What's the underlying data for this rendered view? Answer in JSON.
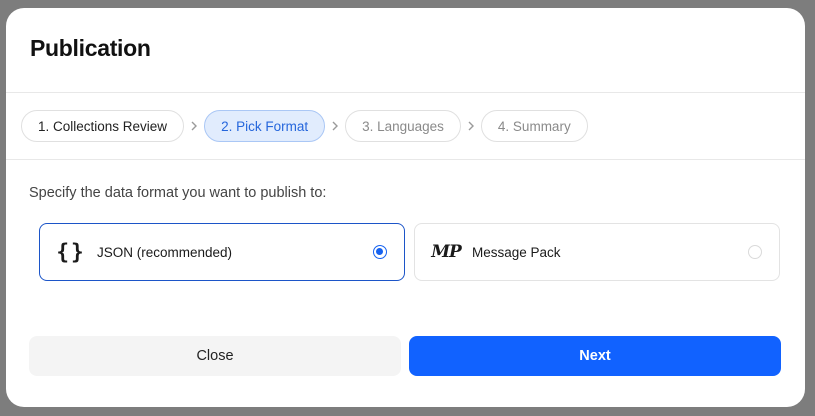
{
  "modal": {
    "title": "Publication"
  },
  "steps": [
    {
      "label": "1. Collections Review",
      "state": "done"
    },
    {
      "label": "2. Pick Format",
      "state": "active"
    },
    {
      "label": "3. Languages",
      "state": "pending"
    },
    {
      "label": "4. Summary",
      "state": "pending"
    }
  ],
  "prompt": "Specify the data format you want to publish to:",
  "options": [
    {
      "icon": "json-braces-icon",
      "glyph": "{}",
      "label": "JSON (recommended)",
      "selected": true
    },
    {
      "icon": "message-pack-icon",
      "glyph": "MP",
      "label": "Message Pack",
      "selected": false
    }
  ],
  "footer": {
    "close_label": "Close",
    "next_label": "Next"
  },
  "colors": {
    "accent": "#1162ff",
    "active_step_bg": "#e1ecfd",
    "active_step_text": "#2566dc"
  }
}
